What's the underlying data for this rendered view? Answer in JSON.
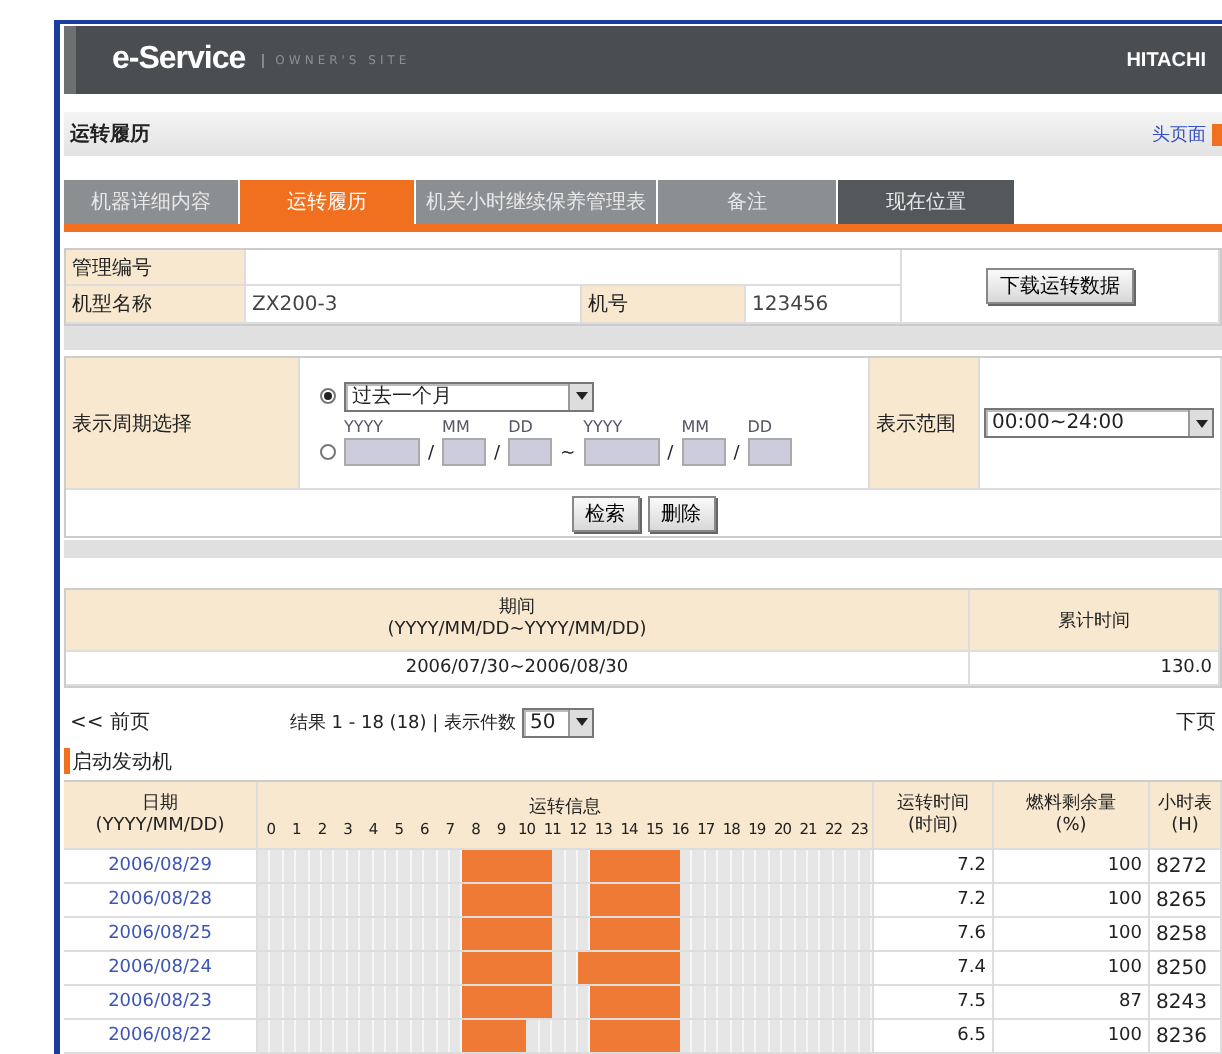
{
  "header": {
    "logo": "e-Service",
    "subtitle": "OWNER'S SITE",
    "brand": "HITACHI"
  },
  "page": {
    "title": "运转履历",
    "home_link": "头页面"
  },
  "tabs": [
    {
      "label": "机器详细内容",
      "selected": false,
      "kind": "tab"
    },
    {
      "label": "运转履历",
      "selected": true,
      "kind": "tab"
    },
    {
      "label": "机关小时继续保养管理表",
      "selected": false,
      "kind": "tab"
    },
    {
      "label": "备注",
      "selected": false,
      "kind": "tab"
    },
    {
      "label": "现在位置",
      "selected": false,
      "kind": "location"
    }
  ],
  "machine_info": {
    "management_no_label": "管理编号",
    "model_label": "机型名称",
    "model_value": "ZX200-3",
    "serial_label": "机号",
    "serial_value": "123456",
    "download_button": "下载运转数据"
  },
  "period": {
    "label": "表示周期选择",
    "preset": {
      "selected": true,
      "value": "过去一个月"
    },
    "custom": {
      "selected": false,
      "captions": [
        "YYYY",
        "MM",
        "DD",
        "YYYY",
        "MM",
        "DD"
      ],
      "date_separator": "/",
      "range_separator": "~"
    },
    "range_label": "表示范围",
    "range_value": "00:00~24:00",
    "buttons": [
      "检索",
      "删除"
    ]
  },
  "summary": {
    "period_title": "期间",
    "period_format": "(YYYY/MM/DD~YYYY/MM/DD)",
    "total_title": "累计时间",
    "period_value": "2006/07/30~2006/08/30",
    "total_value": "130.0"
  },
  "pager": {
    "prev": "<< 前页",
    "results": "结果 1 - 18 (18) | 表示件数",
    "page_size": "50",
    "next": "下页"
  },
  "log": {
    "section_title": "启动发动机",
    "date_title": "日期",
    "date_format": "(YYYY/MM/DD)",
    "info_title": "运转信息",
    "hours_title": "运转时间",
    "hours_unit": "(时间)",
    "fuel_title": "燃料剩余量",
    "fuel_unit": "(%)",
    "meter_title": "小时表",
    "meter_unit": "(H)",
    "hour_labels": [
      "0",
      "1",
      "2",
      "3",
      "4",
      "5",
      "6",
      "7",
      "8",
      "9",
      "10",
      "11",
      "12",
      "13",
      "14",
      "15",
      "16",
      "17",
      "18",
      "19",
      "20",
      "21",
      "22",
      "23"
    ],
    "rows": [
      {
        "date": "2006/08/29",
        "slots": [
          false,
          false,
          false,
          false,
          false,
          false,
          false,
          false,
          false,
          false,
          false,
          false,
          false,
          false,
          false,
          false,
          true,
          true,
          true,
          true,
          true,
          true,
          true,
          false,
          false,
          false,
          true,
          true,
          true,
          true,
          true,
          true,
          true,
          false,
          false,
          false,
          false,
          false,
          false,
          false,
          false,
          false,
          false,
          false,
          false,
          false,
          false,
          false
        ],
        "hours": "7.2",
        "fuel": "100",
        "meter": "8272"
      },
      {
        "date": "2006/08/28",
        "slots": [
          false,
          false,
          false,
          false,
          false,
          false,
          false,
          false,
          false,
          false,
          false,
          false,
          false,
          false,
          false,
          false,
          true,
          true,
          true,
          true,
          true,
          true,
          true,
          false,
          false,
          false,
          true,
          true,
          true,
          true,
          true,
          true,
          true,
          false,
          false,
          false,
          false,
          false,
          false,
          false,
          false,
          false,
          false,
          false,
          false,
          false,
          false,
          false
        ],
        "hours": "7.2",
        "fuel": "100",
        "meter": "8265"
      },
      {
        "date": "2006/08/25",
        "slots": [
          false,
          false,
          false,
          false,
          false,
          false,
          false,
          false,
          false,
          false,
          false,
          false,
          false,
          false,
          false,
          false,
          true,
          true,
          true,
          true,
          true,
          true,
          true,
          false,
          false,
          false,
          true,
          true,
          true,
          true,
          true,
          true,
          true,
          false,
          false,
          false,
          false,
          false,
          false,
          false,
          false,
          false,
          false,
          false,
          false,
          false,
          false,
          false
        ],
        "hours": "7.6",
        "fuel": "100",
        "meter": "8258"
      },
      {
        "date": "2006/08/24",
        "slots": [
          false,
          false,
          false,
          false,
          false,
          false,
          false,
          false,
          false,
          false,
          false,
          false,
          false,
          false,
          false,
          false,
          true,
          true,
          true,
          true,
          true,
          true,
          true,
          false,
          false,
          true,
          true,
          true,
          true,
          true,
          true,
          true,
          true,
          false,
          false,
          false,
          false,
          false,
          false,
          false,
          false,
          false,
          false,
          false,
          false,
          false,
          false,
          false
        ],
        "hours": "7.4",
        "fuel": "100",
        "meter": "8250"
      },
      {
        "date": "2006/08/23",
        "slots": [
          false,
          false,
          false,
          false,
          false,
          false,
          false,
          false,
          false,
          false,
          false,
          false,
          false,
          false,
          false,
          false,
          true,
          true,
          true,
          true,
          true,
          true,
          true,
          false,
          false,
          false,
          true,
          true,
          true,
          true,
          true,
          true,
          true,
          false,
          false,
          false,
          false,
          false,
          false,
          false,
          false,
          false,
          false,
          false,
          false,
          false,
          false,
          false
        ],
        "hours": "7.5",
        "fuel": "87",
        "meter": "8243"
      },
      {
        "date": "2006/08/22",
        "slots": [
          false,
          false,
          false,
          false,
          false,
          false,
          false,
          false,
          false,
          false,
          false,
          false,
          false,
          false,
          false,
          false,
          true,
          true,
          true,
          true,
          true,
          false,
          false,
          false,
          false,
          false,
          true,
          true,
          true,
          true,
          true,
          true,
          true,
          false,
          false,
          false,
          false,
          false,
          false,
          false,
          false,
          false,
          false,
          false,
          false,
          false,
          false,
          false
        ],
        "hours": "6.5",
        "fuel": "100",
        "meter": "8236"
      }
    ]
  }
}
